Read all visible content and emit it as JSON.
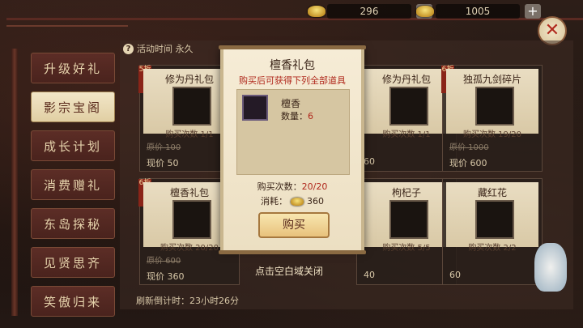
{
  "currency": {
    "gold": {
      "value": "296",
      "icon": "gold-ingot-icon"
    },
    "ingot": {
      "value": "1005",
      "icon": "ingot-icon"
    },
    "plus_label": "+"
  },
  "close_label": "✕",
  "activity_time": "活动时间  永久",
  "sidebar": {
    "items": [
      {
        "label": "升级好礼",
        "active": false
      },
      {
        "label": "影宗宝阁",
        "active": true
      },
      {
        "label": "成长计划",
        "active": false
      },
      {
        "label": "消费赠礼",
        "active": false
      },
      {
        "label": "东岛探秘",
        "active": false
      },
      {
        "label": "见贤思齐",
        "active": false
      },
      {
        "label": "笑傲归来",
        "active": false
      }
    ]
  },
  "cards": [
    {
      "name": "修为丹礼包",
      "count": "购买次数 1/1",
      "old_price": "原价 100",
      "price": "现价 50",
      "badge": "5折"
    },
    {
      "name": "修为丹礼包",
      "count": "购买次数 1/1",
      "old_price": "",
      "price": "60",
      "badge": ""
    },
    {
      "name": "独孤九剑碎片",
      "count": "购买次数 19/20",
      "old_price": "原价 1000",
      "price": "现价 600",
      "badge": "6折"
    },
    {
      "name": "檀香礼包",
      "count": "购买次数 20/20",
      "old_price": "原价 600",
      "price": "现价 360",
      "badge": "6折"
    },
    {
      "name": "枸杞子",
      "count": "购买次数 5/5",
      "old_price": "",
      "price": "40",
      "badge": ""
    },
    {
      "name": "藏红花",
      "count": "购买次数 2/2",
      "old_price": "",
      "price": "60",
      "badge": ""
    }
  ],
  "popup": {
    "title": "檀香礼包",
    "subtitle": "购买后可获得下列全部道具",
    "item_name": "檀香",
    "qty_label": "数量：",
    "qty_value": "6",
    "buy_label": "购买次数：",
    "buy_value": "20/20",
    "cost_label": "消耗：",
    "cost_value": "360",
    "button": "购买"
  },
  "hint": "点击空白域关闭",
  "refresh_label": "刷新倒计时：",
  "refresh_value": "23小时26分"
}
